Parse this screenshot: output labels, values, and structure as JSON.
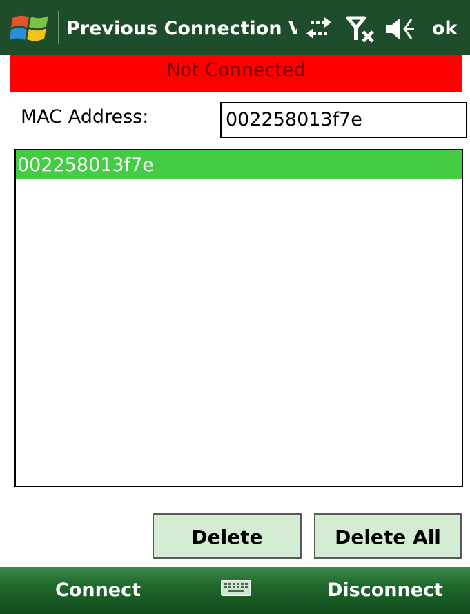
{
  "window": {
    "title": "Previous Connection V",
    "ok_label": "ok",
    "icons": [
      "windows-start-icon",
      "connectivity-icon",
      "no-signal-icon",
      "volume-icon"
    ]
  },
  "status": {
    "text": "Not Connected",
    "color": "#ff0000"
  },
  "mac": {
    "label": "MAC Address:",
    "value": "002258013f7e"
  },
  "list": {
    "items": [
      {
        "label": "002258013f7e",
        "selected": true
      }
    ],
    "selected_color": "#44cc44"
  },
  "buttons": {
    "delete_label": "Delete",
    "delete_all_label": "Delete All"
  },
  "softkeys": {
    "left_label": "Connect",
    "right_label": "Disconnect",
    "center_icon": "keyboard-icon"
  },
  "colors": {
    "titlebar": "#1e4d2b",
    "button_bg": "#d4ecd4",
    "softbar": "#216b2e"
  }
}
